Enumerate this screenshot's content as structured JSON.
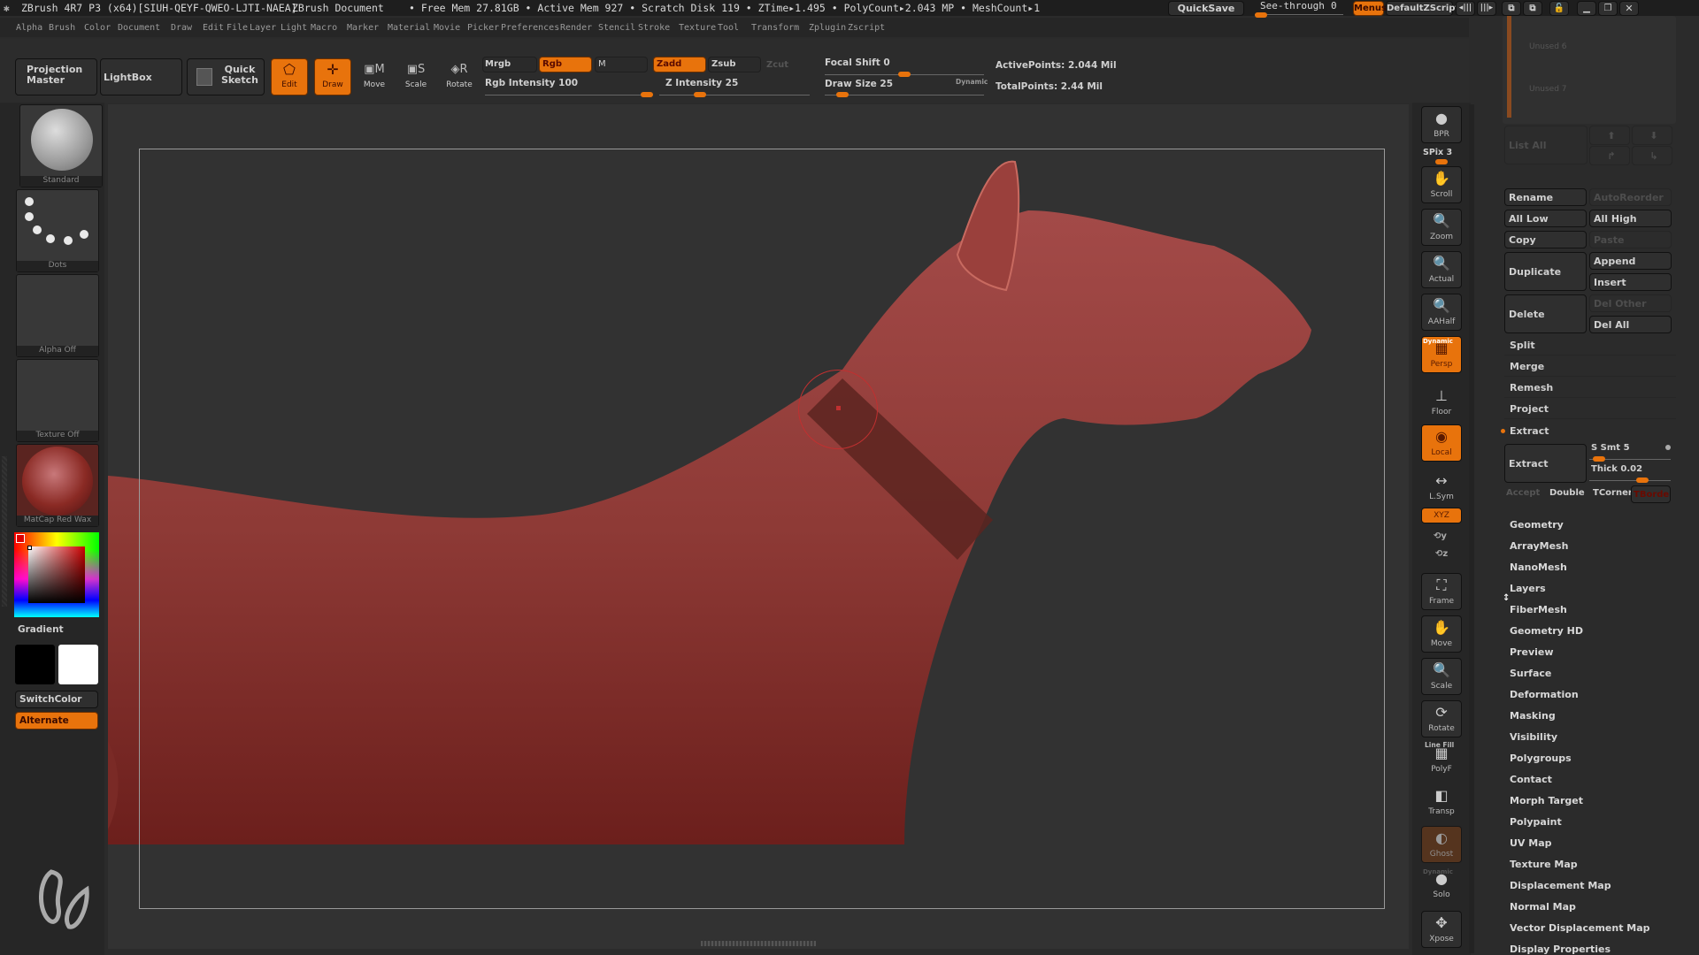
{
  "titlebar": {
    "app": "ZBrush 4R7 P3 (x64)[SIUH-QEYF-QWEO-LJTI-NAEA]",
    "document": "ZBrush Document",
    "stats": "• Free Mem 27.81GB • Active Mem 927 • Scratch Disk 119 • ZTime▸1.495 • PolyCount▸2.043 MP • MeshCount▸1",
    "quicksave": "QuickSave",
    "see_through_label": "See-through",
    "see_through_value": "0",
    "see_through_fraction": 0.0,
    "menus": "Menus",
    "zscript": "DefaultZScript"
  },
  "menubar": [
    "Alpha",
    "Brush",
    "Color",
    "Document",
    "Draw",
    "Edit",
    "File",
    "Layer",
    "Light",
    "Macro",
    "Marker",
    "Material",
    "Movie",
    "Picker",
    "Preferences",
    "Render",
    "Stencil",
    "Stroke",
    "Texture",
    "Tool",
    "Transform",
    "Zplugin",
    "Zscript"
  ],
  "topshelf": {
    "projection_master": "Projection Master",
    "lightbox": "LightBox",
    "quick_sketch": "Quick Sketch",
    "edit": "Edit",
    "draw": "Draw",
    "move": "Move",
    "scale": "Scale",
    "rotate": "Rotate",
    "mrgb": "Mrgb",
    "rgb": "Rgb",
    "m": "M",
    "rgb_intensity": "Rgb Intensity 100",
    "rgb_intensity_fraction": 1.0,
    "zadd": "Zadd",
    "zsub": "Zsub",
    "zcut": "Zcut",
    "z_intensity": "Z Intensity 25",
    "z_intensity_fraction": 0.25,
    "focal_shift": "Focal Shift 0",
    "focal_shift_fraction": 0.5,
    "draw_size": "Draw Size 25",
    "draw_size_fraction": 0.08,
    "dynamic": "Dynamic",
    "active_points": "ActivePoints: 2.044 Mil",
    "total_points": "TotalPoints: 2.44 Mil"
  },
  "leftshelf": {
    "brush": "Standard",
    "stroke": "Dots",
    "alpha": "Alpha Off",
    "texture": "Texture Off",
    "material": "MatCap Red Wax",
    "gradient": "Gradient",
    "switch_color": "SwitchColor",
    "alternate": "Alternate",
    "main_color": "#000000",
    "secondary_color": "#ffffff"
  },
  "rightcol": {
    "bpr": "BPR",
    "spix": "SPix 3",
    "items": [
      "Scroll",
      "Zoom",
      "Actual",
      "AAHalf",
      "Persp",
      "Floor",
      "Local",
      "L.Sym",
      "XYZ",
      "Frame",
      "Move",
      "Scale",
      "Rotate",
      "PolyF",
      "Transp",
      "Ghost",
      "Solo",
      "Xpose"
    ],
    "dynamic": "Dynamic",
    "line_fill": "Line Fill"
  },
  "panel": {
    "layers": [
      "Unused 6",
      "Unused 7"
    ],
    "list_all": "List All",
    "rename": "Rename",
    "autoreorder": "AutoReorder",
    "all_low": "All Low",
    "all_high": "All High",
    "copy": "Copy",
    "paste": "Paste",
    "duplicate": "Duplicate",
    "append": "Append",
    "insert": "Insert",
    "delete": "Delete",
    "del_other": "Del Other",
    "del_all": "Del All",
    "split": "Split",
    "merge": "Merge",
    "remesh": "Remesh",
    "project": "Project",
    "extract_header": "Extract",
    "extract_btn": "Extract",
    "s_smt": "S Smt 5",
    "s_smt_fraction": 0.05,
    "thick": "Thick 0.02",
    "thick_fraction": 0.68,
    "accept": "Accept",
    "double": "Double",
    "tcorner": "TCorner",
    "tborder": "TBorde",
    "subpalettes": [
      "Geometry",
      "ArrayMesh",
      "NanoMesh",
      "Layers",
      "FiberMesh",
      "Geometry HD",
      "Preview",
      "Surface",
      "Deformation",
      "Masking",
      "Visibility",
      "Polygroups",
      "Contact",
      "Morph Target",
      "Polypaint",
      "UV Map",
      "Texture Map",
      "Displacement Map",
      "Normal Map",
      "Vector Displacement Map",
      "Display Properties"
    ]
  },
  "colors": {
    "accent": "#e8730c",
    "model": "#8c2a26"
  }
}
